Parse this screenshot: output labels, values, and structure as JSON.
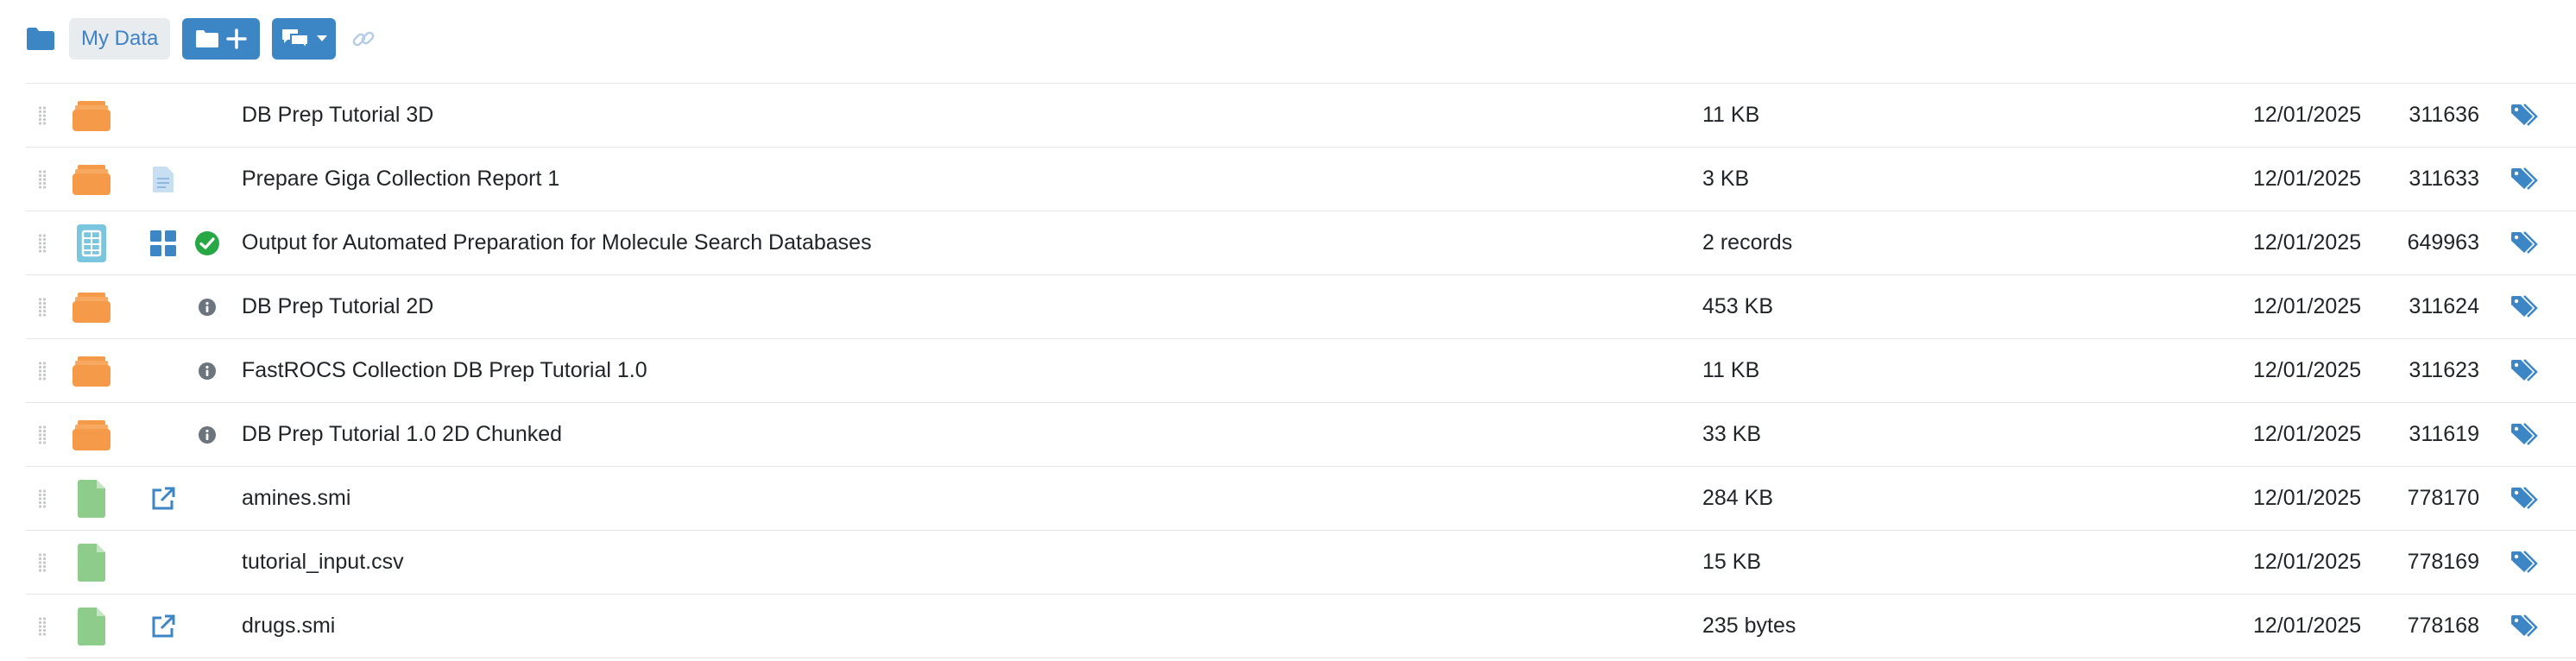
{
  "toolbar": {
    "breadcrumb_label": "My Data",
    "folder_icon": "folder-icon",
    "new_folder_icon": "folder-plus-icon",
    "comments_icon": "comments-dropdown-icon",
    "link_icon": "link-icon"
  },
  "colors": {
    "accent": "#3d86c6",
    "collection_orange": "#f59a48",
    "file_green": "#8dcc8a",
    "record_teal": "#7ac6de",
    "success_green": "#28a745",
    "info_gray": "#6c757d"
  },
  "rows": [
    {
      "name": "DB Prep Tutorial 3D",
      "size": "11 KB",
      "date": "12/01/2025",
      "id": "311636",
      "type": "collection-icon",
      "extra": "",
      "status": ""
    },
    {
      "name": "Prepare Giga Collection Report 1",
      "size": "3 KB",
      "date": "12/01/2025",
      "id": "311633",
      "type": "collection-icon",
      "extra": "report-document-icon",
      "status": ""
    },
    {
      "name": "Output for Automated Preparation for Molecule Search Databases",
      "size": "2 records",
      "date": "12/01/2025",
      "id": "649963",
      "type": "dataset-icon",
      "extra": "grid-view-icon",
      "status": "success-check-icon"
    },
    {
      "name": "DB Prep Tutorial 2D",
      "size": "453 KB",
      "date": "12/01/2025",
      "id": "311624",
      "type": "collection-icon",
      "extra": "",
      "status": "info-icon"
    },
    {
      "name": "FastROCS Collection DB Prep Tutorial 1.0",
      "size": "11 KB",
      "date": "12/01/2025",
      "id": "311623",
      "type": "collection-icon",
      "extra": "",
      "status": "info-icon"
    },
    {
      "name": "DB Prep Tutorial 1.0 2D Chunked",
      "size": "33 KB",
      "date": "12/01/2025",
      "id": "311619",
      "type": "collection-icon",
      "extra": "",
      "status": "info-icon"
    },
    {
      "name": "amines.smi",
      "size": "284 KB",
      "date": "12/01/2025",
      "id": "778170",
      "type": "file-icon",
      "extra": "external-link-icon",
      "status": ""
    },
    {
      "name": "tutorial_input.csv",
      "size": "15 KB",
      "date": "12/01/2025",
      "id": "778169",
      "type": "file-icon",
      "extra": "",
      "status": ""
    },
    {
      "name": "drugs.smi",
      "size": "235 bytes",
      "date": "12/01/2025",
      "id": "778168",
      "type": "file-icon",
      "extra": "external-link-icon",
      "status": ""
    }
  ]
}
